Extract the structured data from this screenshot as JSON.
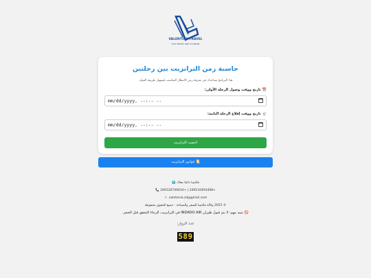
{
  "brand": {
    "name": "VALENTINA TRAVEL",
    "tagline": "FOR TRAVEL AND TOURISM"
  },
  "card": {
    "title": "حاسبة زمن الترانزيت بين رحلتين",
    "description": "هذا البرنامج يساعدك في معرفة زمن الانتظار المناسب لتسهيل طريقة العمل.",
    "arrival_label": "تاريخ ووقت وصول الرحلة الأولى:",
    "arrival_icon": "📆",
    "arrival_value": "mm/dd/yyyy, --:-- --",
    "departure_label": "تاريخ ووقت إقلاع الرحلة الثانية:",
    "departure_icon": "🛫",
    "departure_value": "mm/dd/yyyy, --:-- --",
    "calculate_button": "احسب الترانزيت"
  },
  "laws_button": "📜 قوانين الترانزيت",
  "footer": {
    "tagline": "🌍 فالنتينا دائمًا معاك",
    "phones": "📞 249126749414+ | 249116493408+",
    "email": "📧 valntenia.sd@gmail.com",
    "copyright": "© 2025 وكالة فالنتينا للسفر والسياحة - جميع الحقوق محفوظة"
  },
  "notice": "🚫 تنبيه مهم: لا يتم قبول طيران INDADO AIR في الترانزيت، الرجاء التحقق قبل الحجز.",
  "visitors": {
    "label": "عدد الزوار:",
    "count": "589"
  },
  "colors": {
    "primary": "#1a82f0",
    "success": "#2ea646",
    "title": "#1e88d8"
  }
}
